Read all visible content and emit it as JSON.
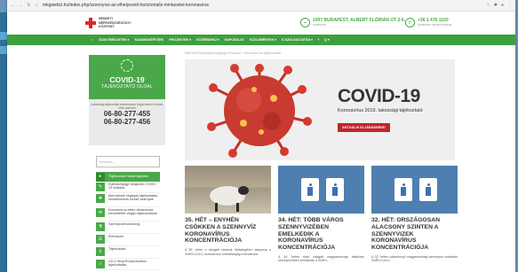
{
  "browser": {
    "url": "mkgwebci.hu/index.php/szennyviz-az-elhelyezett-horizontalis-mintavetel-koronavirus"
  },
  "header": {
    "logo_lines": [
      "NEMZETI",
      "NÉPEGÉSZSÉGÜGYI",
      "KÖZPONT"
    ],
    "address": "1097 BUDAPEST, ALBERT FLÓRIÁN ÚT 2-6.",
    "address_sub": "KÖZPONTI",
    "phone": "+36 1 476 1100",
    "phone_sub": "KÖZPONTI TELEFONSZÁM"
  },
  "menu": [
    "SZAKTERÜLETEK ▾",
    "SZAKMÁKÉRTŐEK",
    "PROJEKTEK ▾",
    "KÖZÉRDEKŰ ▾",
    "KAPCSOLAT",
    "KÖZLEMÉNYEK ▾",
    "E-SZOLGÁLTATÁS ▾",
    "f",
    "Q ▾"
  ],
  "breadcrumb": "Nemzeti Népegészségügyi Központ › koronavírus tájékoztató",
  "sidebar": {
    "covid_title": "COVID-19",
    "covid_sub": "TÁJÉKOZTATÓ OLDAL",
    "hotline_label": "Lakossági tájékoztató telefonszám (ingyenesen hívható zöld számok)",
    "phone1": "06-80-277-455",
    "phone2": "06-80-277-456",
    "search_placeholder": "Keresés...",
    "items": [
      {
        "label": "Tájékoztató Iroda/Ügyfelek",
        "icon": "▸"
      },
      {
        "label": "Egészségügyi dolgozók COVID-19 ellátása",
        "icon": "✎"
      },
      {
        "label": "Mérnöknek véglajdó tájékoztatás vezetéseknek kezdő szárnyak",
        "icon": "✚"
      },
      {
        "label": "Koronavírus elleni oltásmenet kiemeltetett véglyó tájékoztatunk",
        "icon": "✉"
      },
      {
        "label": "Szennyvízmonitoring",
        "icon": "⚗"
      },
      {
        "label": "Élelmiszer",
        "icon": "☰"
      },
      {
        "label": "Tájékoztató",
        "icon": "ℹ"
      },
      {
        "label": "UV-C fényről kapcsolatos tájékoztatás",
        "icon": "☼"
      }
    ]
  },
  "hero": {
    "title": "COVID-19",
    "subtitle": "Koronavírus 2019. lakossági tájékoztató",
    "button": "AKTUÁLIS ELJÁRÁSREND"
  },
  "cards": [
    {
      "title": "35. HÉT – ENYHÉN CSÖKKEN A SZENNYVÍZ KORONAVÍRUS KONCENTRÁCIÓJA",
      "text": "A 35. héten a vizsgált városok többségében alacsony a SARS-CoV-2 koronavírus örökítőanyag a tendencia"
    },
    {
      "title": "34. HÉT: TÖBB VÁROS SZENNYVIZÉBEN EMELKEDIK A KORONAVÍRUS KONCENTRÁCIÓJA",
      "text": "A 34. héten több vizsgált magyarországi település szennyvizében emelkedik a SARS-"
    },
    {
      "title": "32. HÉT: ORSZÁGOSAN ALACSONY SZINTEN A SZENNYVIZEK KORONAVÍRUS KONCENTRÁCIÓJA",
      "text": "A 32. héten valamennyi magyarországi szennyvíz mintában SARS-CoV-2"
    }
  ]
}
